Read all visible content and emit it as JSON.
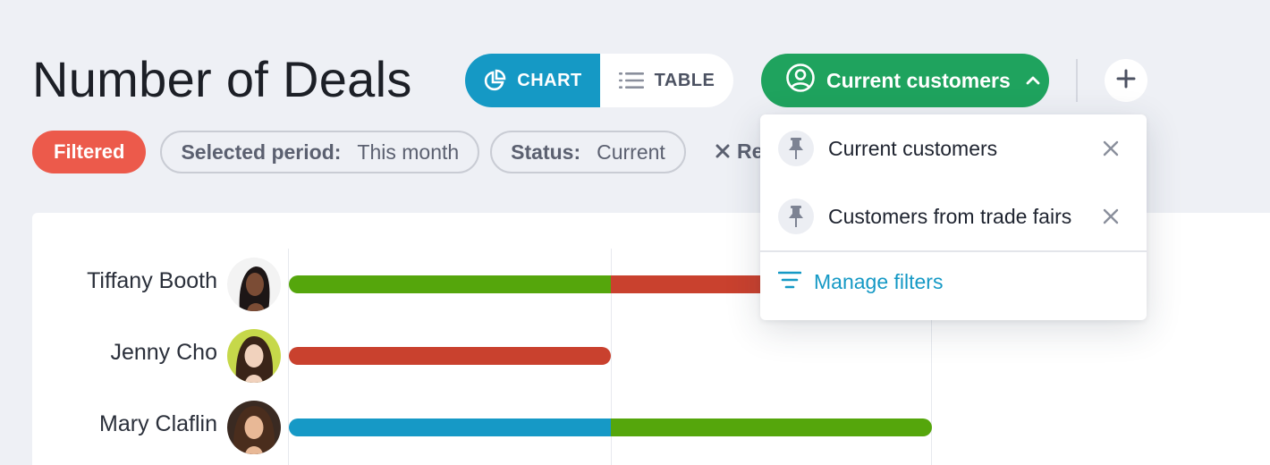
{
  "header": {
    "title": "Number of Deals"
  },
  "view_toggle": {
    "chart_label": "CHART",
    "table_label": "TABLE",
    "active": "chart"
  },
  "filter_button": {
    "label": "Current customers",
    "icon": "user-circle-icon",
    "open": true
  },
  "chips": {
    "filtered_label": "Filtered",
    "period_key": "Selected period:",
    "period_value": "This month",
    "status_key": "Status:",
    "status_value": "Current",
    "reset_label": "Re"
  },
  "dropdown": {
    "items": [
      {
        "label": "Current customers",
        "icon": "pin-icon"
      },
      {
        "label": "Customers from trade fairs",
        "icon": "pin-icon"
      }
    ],
    "manage_label": "Manage filters"
  },
  "colors": {
    "green": "#55a60c",
    "red": "#c9412e",
    "blue": "#1699c6",
    "accent": "#1599c5",
    "filter_green": "#1fa35e",
    "filtered_badge": "#ec5a4b"
  },
  "rows": [
    {
      "name": "Tiffany Booth"
    },
    {
      "name": "Jenny Cho"
    },
    {
      "name": "Mary Claflin"
    }
  ]
}
